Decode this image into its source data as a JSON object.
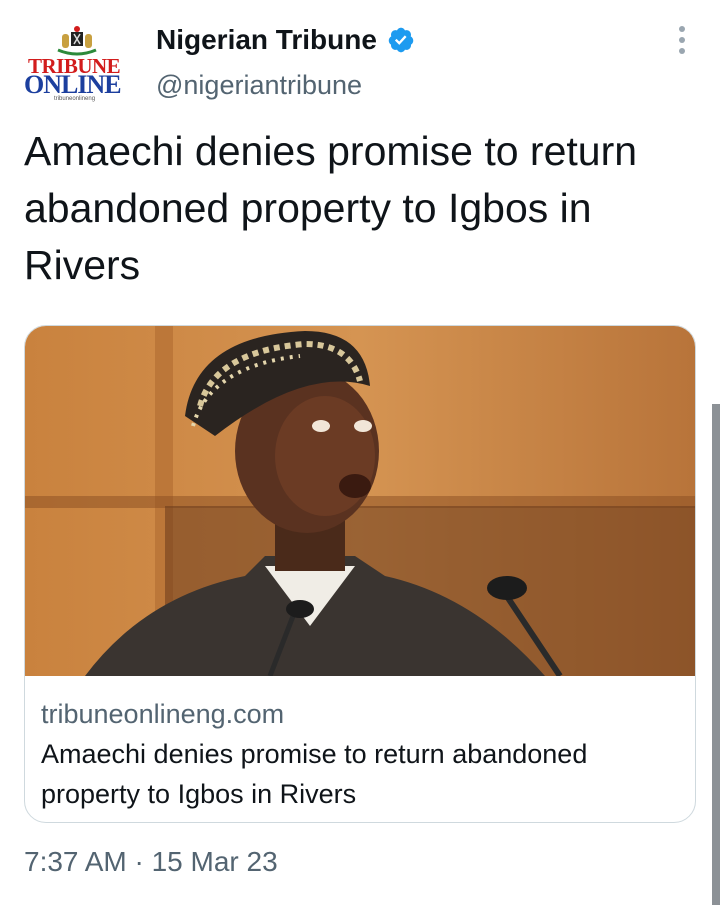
{
  "account": {
    "name": "Nigerian Tribune",
    "handle": "@nigeriantribune",
    "verified": true,
    "avatar_logo": {
      "line1": "TRIBUNE",
      "line2": "ONLINE",
      "sub": "tribuneonlineng"
    }
  },
  "tweet": {
    "text": "Amaechi denies promise to return abandoned property to Igbos in Rivers",
    "timestamp": "7:37 AM · 15 Mar 23"
  },
  "card": {
    "domain": "tribuneonlineng.com",
    "title": "Amaechi denies promise to return abandoned property to Igbos in Rivers"
  },
  "icons": [
    "verified-badge-icon",
    "more-options-icon"
  ],
  "colors": {
    "verified": "#1d9bf0",
    "secondary_text": "#536471",
    "logo_red": "#d21c1c",
    "logo_blue": "#1c3f9e"
  }
}
